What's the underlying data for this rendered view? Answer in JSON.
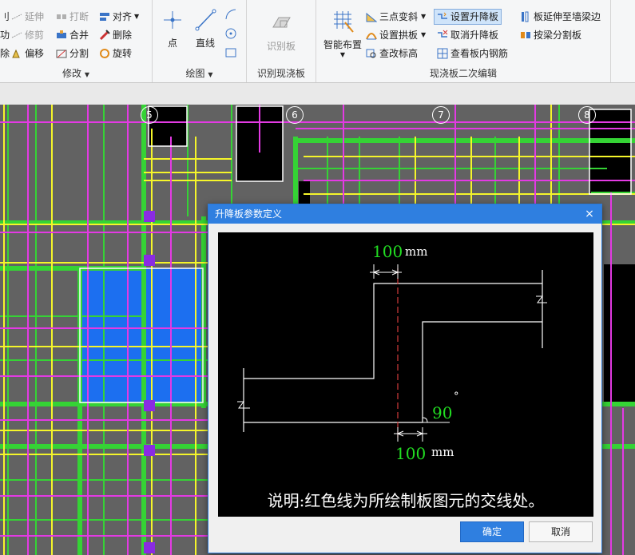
{
  "ribbon": {
    "modify": {
      "label": "修改",
      "col0": [
        "刂",
        "功",
        "除"
      ],
      "col1": [
        "延伸",
        "修剪",
        "偏移"
      ],
      "col2": [
        "打断",
        "合并",
        "分割"
      ],
      "col3": [
        "对齐",
        "删除",
        "旋转"
      ]
    },
    "draw": {
      "label": "绘图",
      "point": "点",
      "line": "直线"
    },
    "recog": {
      "label": "识别现浇板",
      "button": "识别板"
    },
    "secondary": {
      "label": "现浇板二次编辑",
      "smart": "智能布置",
      "c1": [
        "三点变斜",
        "设置拱板",
        "查改标高"
      ],
      "c2": [
        "设置升降板",
        "取消升降板",
        "查看板内钢筋"
      ],
      "c3": [
        "板延伸至墙梁边",
        "按梁分割板"
      ]
    }
  },
  "canvas": {
    "axes": [
      "5",
      "6",
      "7",
      "8"
    ]
  },
  "dialog": {
    "title": "升降板参数定义",
    "close": "×",
    "dim_top": "100",
    "dim_top_unit": "mm",
    "dim_bottom": "100",
    "dim_bottom_unit": "mm",
    "angle": "90",
    "angle_unit": "°",
    "note": "说明:红色线为所绘制板图元的交线处。",
    "ok": "确定",
    "cancel": "取消"
  },
  "colors": {
    "accent": "#2f7fe0",
    "dim_green": "#22dd22",
    "red_line": "#d43c3c"
  }
}
